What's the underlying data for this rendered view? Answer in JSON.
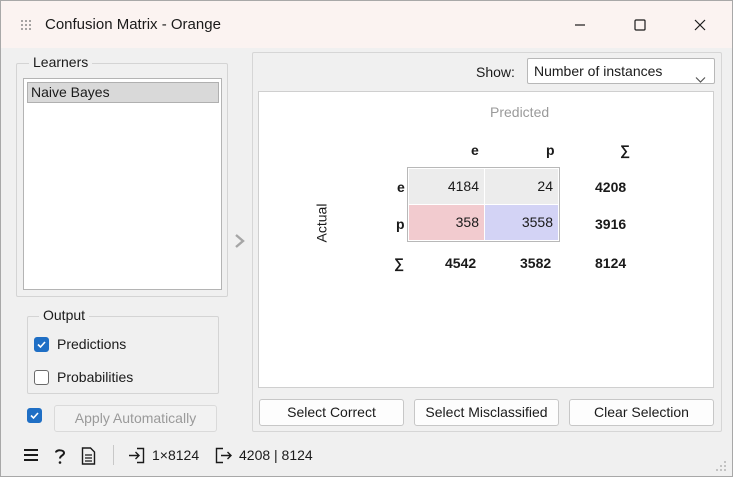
{
  "window": {
    "title": "Confusion Matrix - Orange",
    "icon": "orange-widget-icon"
  },
  "learners": {
    "title": "Learners",
    "items": [
      {
        "label": "Naive Bayes",
        "selected": true
      }
    ]
  },
  "output": {
    "title": "Output",
    "predictions": {
      "label": "Predictions",
      "checked": true
    },
    "probabilities": {
      "label": "Probabilities",
      "checked": false
    }
  },
  "apply": {
    "label": "Apply Automatically",
    "checked": true
  },
  "show": {
    "label": "Show:",
    "value": "Number of instances"
  },
  "matrix": {
    "predicted_label": "Predicted",
    "actual_label": "Actual",
    "sum_symbol": "∑",
    "classes": [
      "e",
      "p"
    ],
    "cells": [
      [
        4184,
        24
      ],
      [
        358,
        3558
      ]
    ],
    "row_totals": [
      4208,
      3916
    ],
    "col_totals": [
      4542,
      3582
    ],
    "grand_total": 8124,
    "colors": {
      "correct_e": "#ececec",
      "correct_p": "#d3d3f5",
      "wrong_e_row": "#ececec",
      "wrong_p_row": "#f2cbcf"
    }
  },
  "buttons": {
    "select_correct": "Select Correct",
    "select_misclassified": "Select Misclassified",
    "clear_selection": "Clear Selection"
  },
  "status": {
    "input_summary": "1×8124",
    "output_summary": "4208 | 8124"
  },
  "colors": {
    "accent": "#1f6fc5",
    "titlebar": "#fbf3f1"
  }
}
